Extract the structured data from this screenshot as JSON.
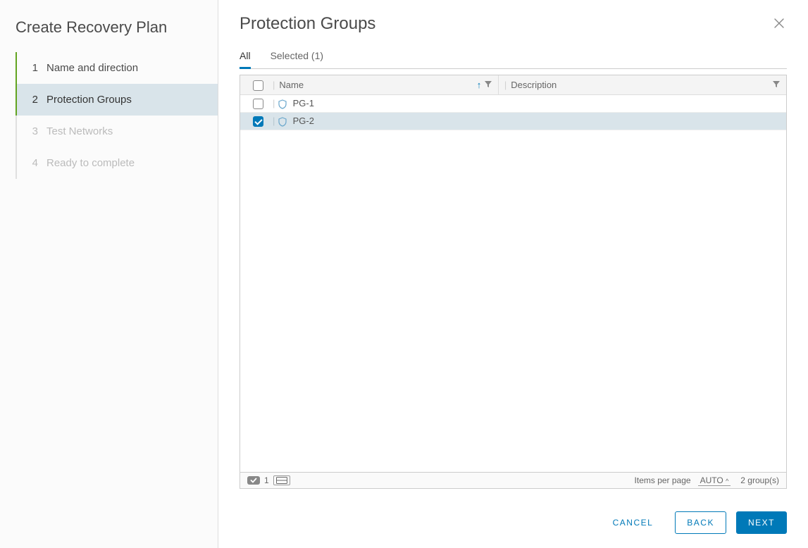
{
  "sidebar": {
    "title": "Create Recovery Plan",
    "steps": [
      {
        "num": "1",
        "label": "Name and direction",
        "state": "completed"
      },
      {
        "num": "2",
        "label": "Protection Groups",
        "state": "current"
      },
      {
        "num": "3",
        "label": "Test Networks",
        "state": "disabled"
      },
      {
        "num": "4",
        "label": "Ready to complete",
        "state": "disabled"
      }
    ]
  },
  "main": {
    "title": "Protection Groups",
    "tabs": {
      "all_label": "All",
      "selected_label": "Selected (1)"
    },
    "columns": {
      "name": "Name",
      "description": "Description"
    },
    "rows": [
      {
        "name": "PG-1",
        "description": "",
        "checked": false
      },
      {
        "name": "PG-2",
        "description": "",
        "checked": true
      }
    ],
    "footer": {
      "selected_count": "1",
      "items_per_page_label": "Items per page",
      "items_per_page_value": "AUTO",
      "total_label": "2 group(s)"
    }
  },
  "actions": {
    "cancel": "CANCEL",
    "back": "BACK",
    "next": "NEXT"
  }
}
